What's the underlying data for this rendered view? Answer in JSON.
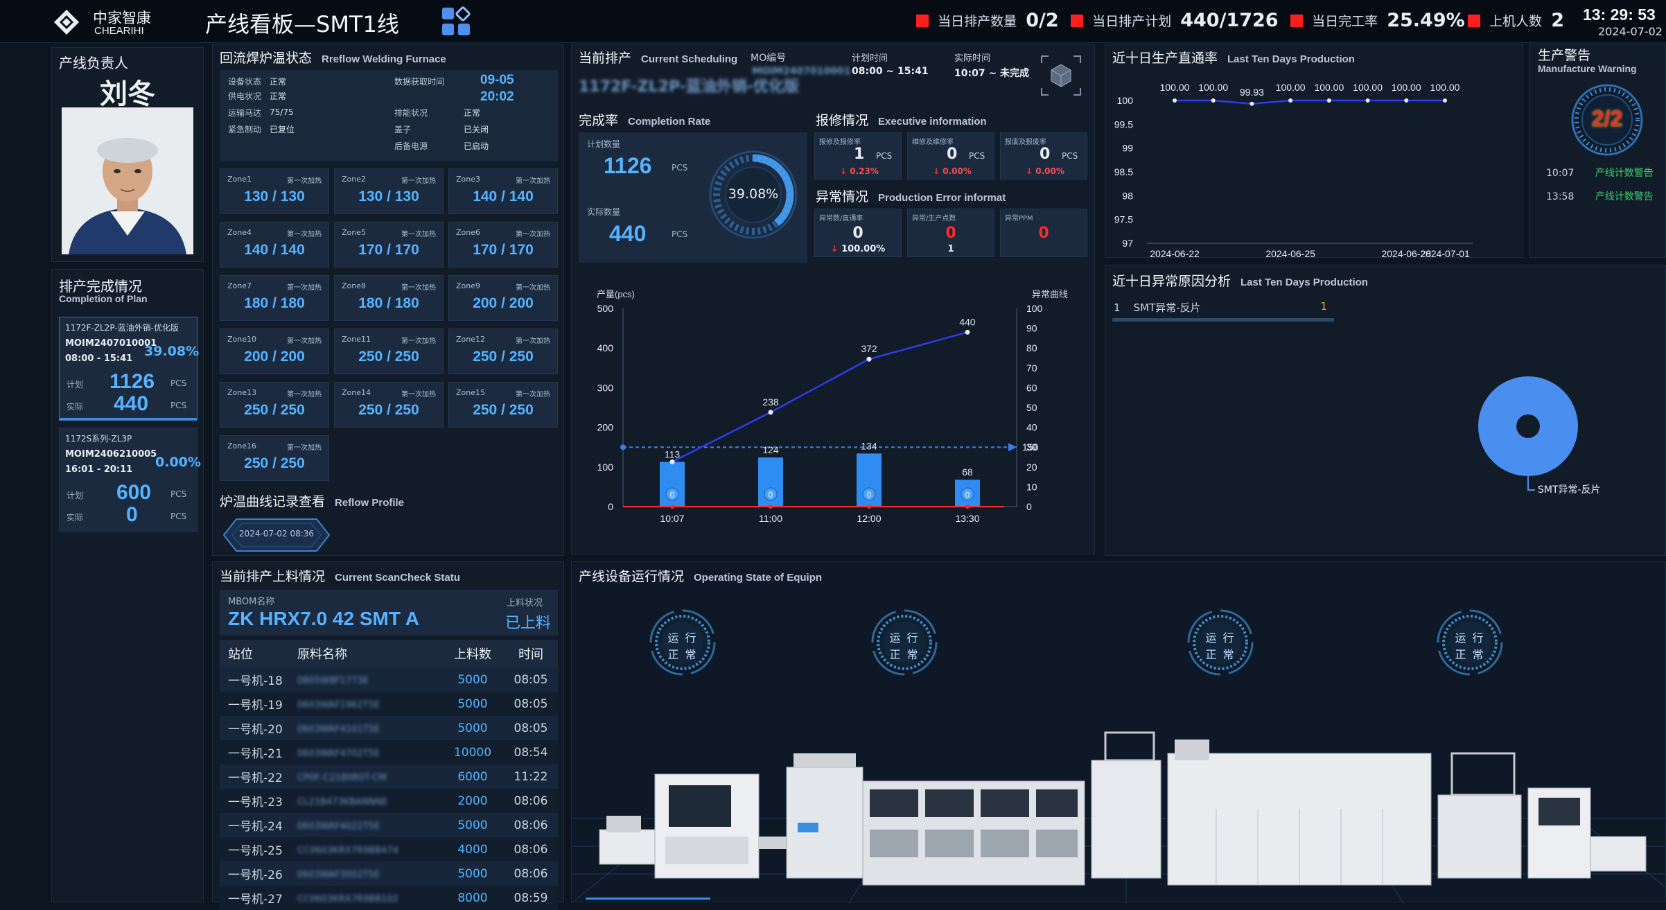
{
  "header": {
    "logo_cn": "中家智康",
    "logo_en": "CHEARIHI",
    "title": "产线看板—SMT1线",
    "stats": [
      {
        "label": "当日排产数量",
        "value": "0/2"
      },
      {
        "label": "当日排产计划",
        "value": "440/1726"
      },
      {
        "label": "当日完工率",
        "value": "25.49%"
      },
      {
        "label": "上机人数",
        "value": "2"
      }
    ],
    "time": "13: 29: 53",
    "date": "2024-07-02",
    "colors": {
      "accent": "#55b3ff",
      "alert": "#ff2a2a",
      "background": "#0d1520"
    }
  },
  "leader": {
    "title": "产线负责人",
    "name": "刘冬"
  },
  "plan": {
    "title": "排产完成情况",
    "title_en": "Completion of Plan",
    "cards": [
      {
        "product": "1172F-ZL2P-蓝油外销-优化版",
        "mo": "MOIM2407010001",
        "time": "08:00 - 15:41",
        "rate": "39.08%",
        "plan_label": "计划",
        "plan": "1126",
        "actual_label": "实际",
        "actual": "440",
        "unit": "PCS"
      },
      {
        "product": "1172S系列-ZL3P",
        "mo": "MOIM2406210005",
        "time": "16:01 - 20:11",
        "rate": "0.00%",
        "plan_label": "计划",
        "plan": "600",
        "actual_label": "实际",
        "actual": "0",
        "unit": "PCS"
      }
    ]
  },
  "reflow": {
    "title": "回流焊炉温状态",
    "title_en": "Rreflow Welding Furnace",
    "status_rows": [
      {
        "k1": "设备状态",
        "v1": "正常",
        "k2": "数据获取时间",
        "v2": ""
      },
      {
        "k1": "供电状况",
        "v1": "正常",
        "k2": "",
        "v2": ""
      },
      {
        "k1": "运输马达",
        "v1": "75/75",
        "k2": "排能状况",
        "v2": "正常"
      },
      {
        "k1": "紧急制动",
        "v1": "已复位",
        "k2": "盖子",
        "v2": "已关闭"
      },
      {
        "k1": "",
        "v1": "",
        "k2": "后备电源",
        "v2": "已启动"
      }
    ],
    "fetch_date": "09-05",
    "fetch_time": "20:02",
    "zone_label": "第一次加热",
    "zones": [
      {
        "name": "Zone1",
        "value": "130 / 130"
      },
      {
        "name": "Zone2",
        "value": "130 / 130"
      },
      {
        "name": "Zone3",
        "value": "140 / 140"
      },
      {
        "name": "Zone4",
        "value": "140 / 140"
      },
      {
        "name": "Zone5",
        "value": "170 / 170"
      },
      {
        "name": "Zone6",
        "value": "170 / 170"
      },
      {
        "name": "Zone7",
        "value": "180 / 180"
      },
      {
        "name": "Zone8",
        "value": "180 / 180"
      },
      {
        "name": "Zone9",
        "value": "200 / 200"
      },
      {
        "name": "Zone10",
        "value": "200 / 200"
      },
      {
        "name": "Zone11",
        "value": "250 / 250"
      },
      {
        "name": "Zone12",
        "value": "250 / 250"
      },
      {
        "name": "Zone13",
        "value": "250 / 250"
      },
      {
        "name": "Zone14",
        "value": "250 / 250"
      },
      {
        "name": "Zone15",
        "value": "250 / 250"
      },
      {
        "name": "Zone16",
        "value": "250 / 250"
      }
    ],
    "profile_title": "炉温曲线记录查看",
    "profile_title_en": "Reflow Profile",
    "profile_date": "2024-07-02 08:36"
  },
  "schedule": {
    "title": "当前排产",
    "title_en": "Current Scheduling",
    "mo_label": "MO编号",
    "mo_value": "1172F-ZL2P-蓝油外销-优化版",
    "mo_number": "MOIM2407010001",
    "plan_time_label": "计划时间",
    "plan_time": "08:00 ~ 15:41",
    "actual_time_label": "实际时间",
    "actual_time": "10:07 ~ 未完成",
    "completion_title": "完成率",
    "completion_title_en": "Completion Rate",
    "plan_qty_label": "计划数量",
    "plan_qty": "1126",
    "actual_qty_label": "实际数量",
    "actual_qty": "440",
    "unit": "PCS",
    "rate": "39.08%",
    "rate_value": 0.3908,
    "repair_title": "报修情况",
    "repair_title_en": "Executive information",
    "repair_cards": [
      {
        "label": "报修及报修率",
        "value": "1",
        "unit": "PCS",
        "pct": "0.23%"
      },
      {
        "label": "维修及维修率",
        "value": "0",
        "unit": "PCS",
        "pct": "0.00%"
      },
      {
        "label": "报废及报废率",
        "value": "0",
        "unit": "PCS",
        "pct": "0.00%"
      }
    ],
    "error_title": "异常情况",
    "error_title_en": "Production Error informat",
    "error_cards": [
      {
        "label": "异常数/直通率",
        "value": "0",
        "sub": "100.00%"
      },
      {
        "label": "异常/生产点数",
        "value": "0",
        "sub": "1"
      },
      {
        "label": "异常PPM",
        "value": "0",
        "sub": ""
      }
    ]
  },
  "chart_data": [
    {
      "type": "bar",
      "title": "",
      "ylabel": "产量(pcs)",
      "y2label": "异常曲线",
      "categories": [
        "10:07",
        "11:00",
        "12:00",
        "13:30"
      ],
      "series": [
        {
          "values": [
            113,
            124,
            134,
            68
          ],
          "kind": "bar",
          "labels": [
            "113",
            "124",
            "134",
            "68"
          ]
        },
        {
          "values": [
            113,
            238,
            372,
            440
          ],
          "kind": "line",
          "labels": [
            "113",
            "238",
            "372",
            "440"
          ]
        },
        {
          "values": [
            0,
            0,
            0,
            0
          ],
          "kind": "bar-labels"
        },
        {
          "values": [
            0,
            0,
            0,
            0
          ],
          "kind": "line",
          "axis": "right"
        }
      ],
      "target": 150,
      "ylim": [
        0,
        500
      ],
      "y2lim": [
        0,
        100
      ],
      "yticks": [
        "0",
        "100",
        "200",
        "300",
        "400",
        "500"
      ],
      "y2ticks": [
        "0",
        "10",
        "20",
        "30",
        "40",
        "50",
        "60",
        "70",
        "80",
        "90",
        "100"
      ]
    },
    {
      "type": "line",
      "title": "近十日生产直通率",
      "title_en": "Last Ten Days Production",
      "x": [
        "2024-06-22",
        "2024-06-23",
        "2024-06-24",
        "2024-06-25",
        "2024-06-26",
        "2024-06-27",
        "2024-06-28",
        "2024-07-01"
      ],
      "xticks": [
        "2024-06-22",
        "2024-06-25",
        "2024-06-28",
        "2024-07-01"
      ],
      "values": [
        100,
        100,
        99.93,
        100,
        100,
        100,
        100,
        100
      ],
      "labels": [
        "100.00",
        "100.00",
        "99.93",
        "100.00",
        "100.00",
        "100.00",
        "100.00",
        "100.00"
      ],
      "ylim": [
        97,
        100
      ],
      "yticks": [
        "97",
        "97.5",
        "98",
        "98.5",
        "99",
        "99.5",
        "100"
      ]
    },
    {
      "type": "pie",
      "title": "近十日异常原因分析",
      "title_en": "Last Ten Days Production",
      "slices": [
        {
          "name": "SMT异常-反片",
          "value": 1
        }
      ],
      "list_index": "1",
      "color": "#4a8ff0"
    }
  ],
  "warning": {
    "title": "生产警告",
    "title_en": "Manufacture Warning",
    "gauge": "2/2",
    "items": [
      {
        "time": "10:07",
        "text": "产线计数警告"
      },
      {
        "time": "13:58",
        "text": "产线计数警告"
      }
    ]
  },
  "material": {
    "title": "当前排产上料情况",
    "title_en": "Current ScanCheck Statu",
    "mbom_label": "MBOM名称",
    "mbom_value": "ZK HRX7.0 42 SMT A",
    "status_label": "上料状况",
    "status_value": "已上料",
    "columns": [
      "站位",
      "原料名称",
      "上料数",
      "时间"
    ],
    "rows": [
      {
        "station": "一号机-18",
        "material": "0805W8F1773E",
        "qty": "5000",
        "time": "08:05"
      },
      {
        "station": "一号机-19",
        "material": "0603WAF1962T5E",
        "qty": "5000",
        "time": "08:05"
      },
      {
        "station": "一号机-20",
        "material": "0603WAF4101T5E",
        "qty": "5000",
        "time": "08:05"
      },
      {
        "station": "一号机-21",
        "material": "0603WAF4702T5E",
        "qty": "10000",
        "time": "08:54"
      },
      {
        "station": "一号机-22",
        "material": "CP0F-C2180R0T-CM",
        "qty": "6000",
        "time": "11:22"
      },
      {
        "station": "一号机-23",
        "material": "CL21B473KBANNNE",
        "qty": "2000",
        "time": "08:06"
      },
      {
        "station": "一号机-24",
        "material": "0603WAF4022T5E",
        "qty": "5000",
        "time": "08:06"
      },
      {
        "station": "一号机-25",
        "material": "CC0603KRX7R9BB474",
        "qty": "4000",
        "time": "08:06"
      },
      {
        "station": "一号机-26",
        "material": "0603WAF3002T5E",
        "qty": "5000",
        "time": "08:06"
      },
      {
        "station": "一号机-27",
        "material": "CC0603KRX7R9BB102",
        "qty": "8000",
        "time": "08:59"
      }
    ]
  },
  "equipment": {
    "title": "产线设备运行情况",
    "title_en": "Operating State of Equipn",
    "badges": [
      {
        "line1": "运 行",
        "line2": "正 常"
      },
      {
        "line1": "运 行",
        "line2": "正 常"
      },
      {
        "line1": "运 行",
        "line2": "正 常"
      },
      {
        "line1": "运 行",
        "line2": "正 常"
      }
    ]
  }
}
